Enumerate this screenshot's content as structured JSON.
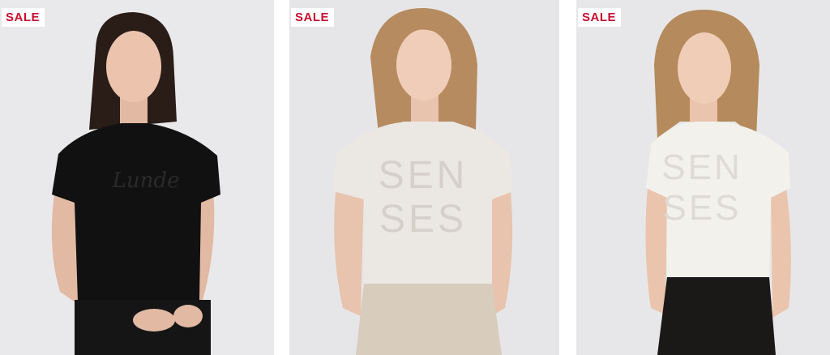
{
  "products": [
    {
      "badge": "SALE",
      "shirt_print": "Lunde",
      "shirt_color": "#111111",
      "bottom_color": "#151515",
      "background": "#e9e9eb"
    },
    {
      "badge": "SALE",
      "shirt_print": "SEN SES",
      "shirt_color": "#ebe7e3",
      "bottom_color": "#d8cdbc",
      "background": "#e6e6e8"
    },
    {
      "badge": "SALE",
      "shirt_print": "SEN SES",
      "shirt_color": "#f3f1ec",
      "bottom_color": "#1b1918",
      "background": "#e7e7e9"
    }
  ]
}
